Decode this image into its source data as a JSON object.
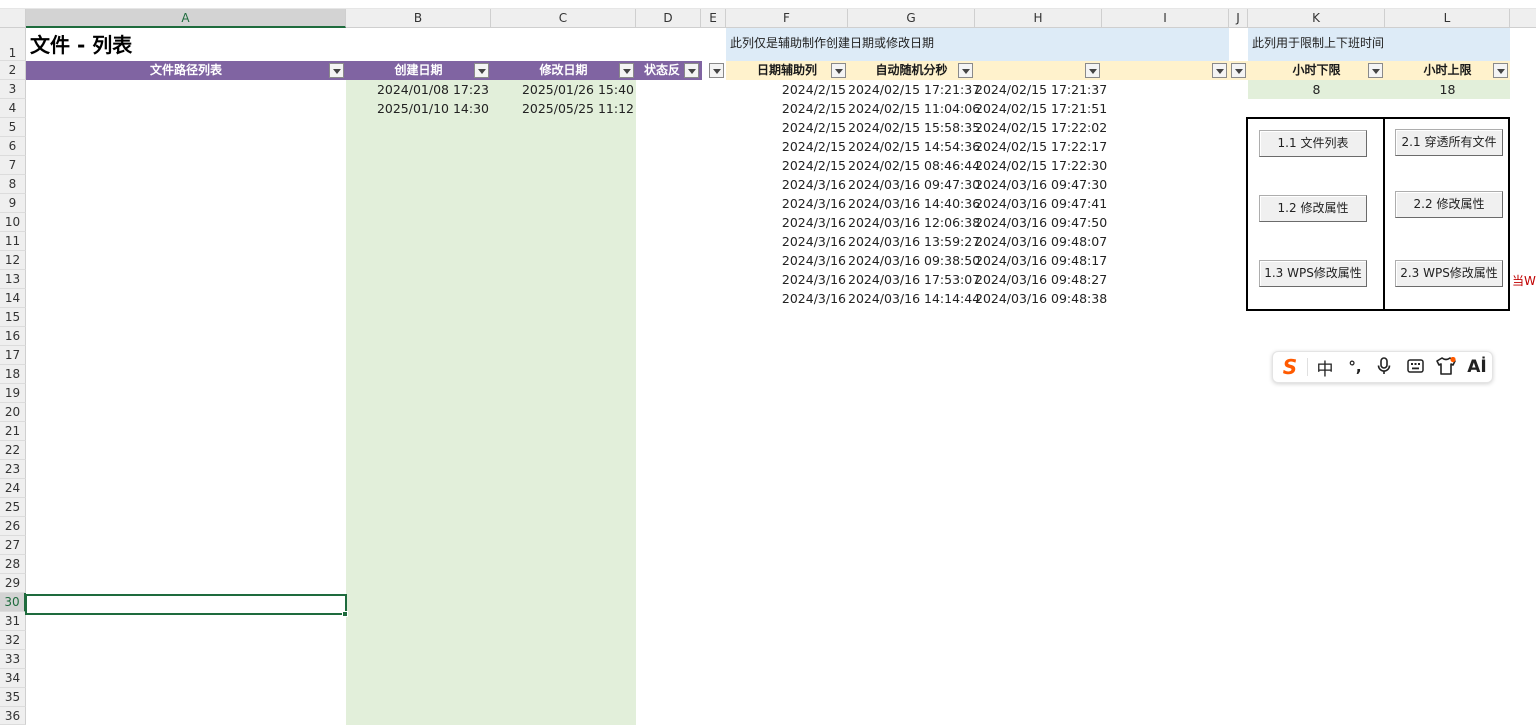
{
  "columns": [
    "A",
    "B",
    "C",
    "D",
    "E",
    "F",
    "G",
    "H",
    "I",
    "J",
    "K",
    "L"
  ],
  "rows": [
    "1",
    "2",
    "3",
    "4",
    "5",
    "6",
    "7",
    "8",
    "9",
    "10",
    "11",
    "12",
    "13",
    "14",
    "15",
    "16",
    "17",
    "18",
    "19",
    "20",
    "21",
    "22",
    "23",
    "24",
    "25",
    "26",
    "27",
    "28",
    "29",
    "30",
    "31",
    "32",
    "33",
    "34",
    "35",
    "36"
  ],
  "title": "文件 - 列表",
  "notes": {
    "date_helper": "此列仅是辅助制作创建日期或修改日期",
    "hour_limit": "此列用于限制上下班时间"
  },
  "headers": {
    "file_path": "文件路径列表",
    "created": "创建日期",
    "modified": "修改日期",
    "status": "状态反馈",
    "date_helper": "日期辅助列",
    "auto_random": "自动随机分秒",
    "hour_min": "小时下限",
    "hour_max": "小时上限"
  },
  "file_rows": [
    {
      "created": "2024/01/08 17:23",
      "modified": "2025/01/26 15:40"
    },
    {
      "created": "2025/01/10 14:30",
      "modified": "2025/05/25 11:12"
    }
  ],
  "helper_rows": [
    {
      "f": "2024/2/15",
      "g": "2024/02/15 17:21:37",
      "h": "2024/02/15 17:21:37"
    },
    {
      "f": "2024/2/15",
      "g": "2024/02/15 11:04:06",
      "h": "2024/02/15 17:21:51"
    },
    {
      "f": "2024/2/15",
      "g": "2024/02/15 15:58:35",
      "h": "2024/02/15 17:22:02"
    },
    {
      "f": "2024/2/15",
      "g": "2024/02/15 14:54:36",
      "h": "2024/02/15 17:22:17"
    },
    {
      "f": "2024/2/15",
      "g": "2024/02/15 08:46:44",
      "h": "2024/02/15 17:22:30"
    },
    {
      "f": "2024/3/16",
      "g": "2024/03/16 09:47:30",
      "h": "2024/03/16 09:47:30"
    },
    {
      "f": "2024/3/16",
      "g": "2024/03/16 14:40:36",
      "h": "2024/03/16 09:47:41"
    },
    {
      "f": "2024/3/16",
      "g": "2024/03/16 12:06:38",
      "h": "2024/03/16 09:47:50"
    },
    {
      "f": "2024/3/16",
      "g": "2024/03/16 13:59:27",
      "h": "2024/03/16 09:48:07"
    },
    {
      "f": "2024/3/16",
      "g": "2024/03/16 09:38:50",
      "h": "2024/03/16 09:48:17"
    },
    {
      "f": "2024/3/16",
      "g": "2024/03/16 17:53:07",
      "h": "2024/03/16 09:48:27"
    },
    {
      "f": "2024/3/16",
      "g": "2024/03/16 14:14:44",
      "h": "2024/03/16 09:48:38"
    }
  ],
  "hour_values": {
    "min": "8",
    "max": "18"
  },
  "buttons": {
    "b11": "1.1 文件列表",
    "b12": "1.2 修改属性",
    "b13": "1.3 WPS修改属性",
    "b21": "2.1 穿透所有文件",
    "b22": "2.2 修改属性",
    "b23": "2.3 WPS修改属性"
  },
  "overflow_note": "当W",
  "ime_toolbar": {
    "logo": "S",
    "mode": "中",
    "punct": "°,",
    "icons": [
      "voice-mic-icon",
      "keyboard-icon",
      "skin-shirt-icon",
      "ai-text-icon"
    ],
    "ai_label": "Aİ"
  },
  "colors": {
    "header_purple": "#8064a2",
    "cell_green": "#e2efda",
    "cell_blue": "#ddebf7",
    "header_yellow": "#fff2cc",
    "selection_green": "#1e6b3d",
    "ime_orange": "#ff5a00",
    "note_red": "#c00000"
  }
}
